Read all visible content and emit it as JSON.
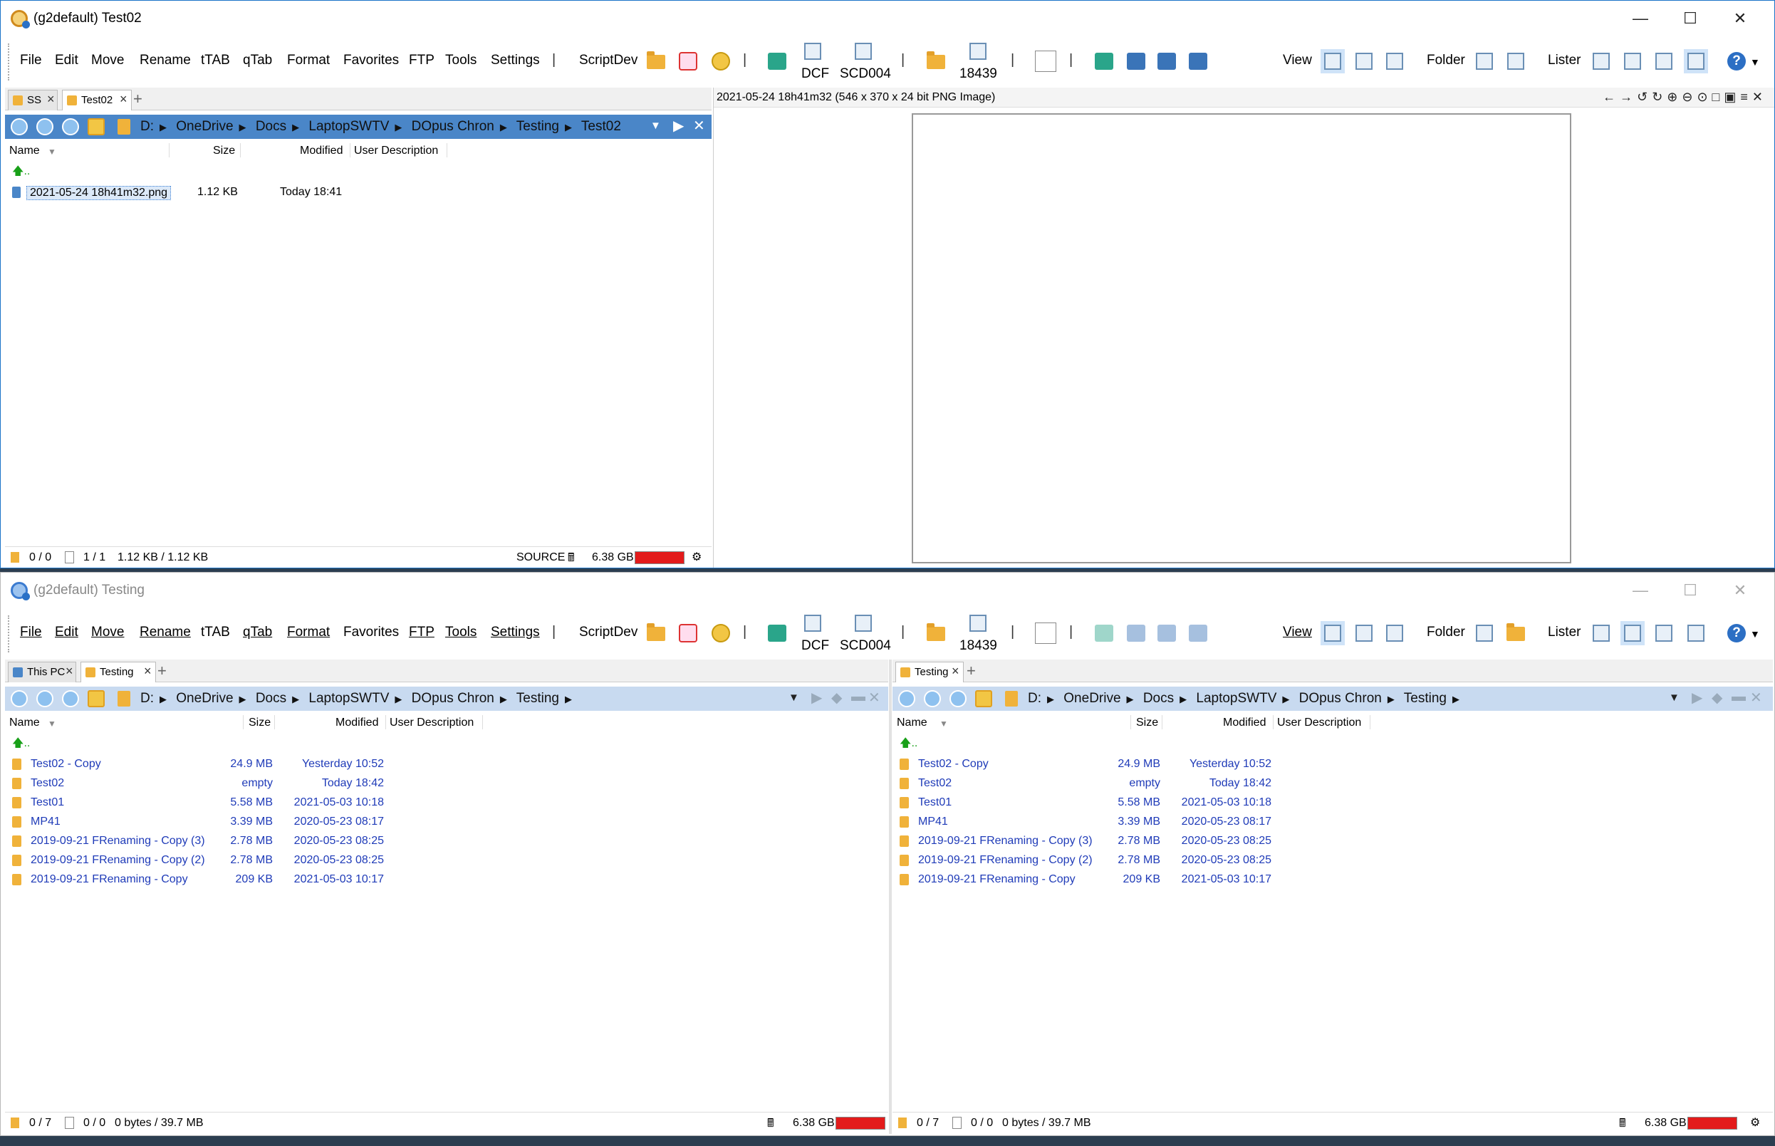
{
  "window1": {
    "title": "(g2default) Test02",
    "menu": [
      "File",
      "Edit",
      "Move",
      "Rename",
      "tTAB",
      "qTab",
      "Format",
      "Favorites",
      "FTP",
      "Tools",
      "Settings"
    ],
    "menu_sep": "|",
    "scriptdev": "ScriptDev",
    "dcf": "DCF",
    "scd004": "SCD004",
    "count_18439": "18439",
    "view_label": "View",
    "folder_label": "Folder",
    "lister_label": "Lister",
    "tabs": [
      {
        "label": "SS"
      },
      {
        "label": "Test02"
      }
    ],
    "path": [
      "D:",
      "OneDrive",
      "Docs",
      "LaptopSWTV",
      "DOpus Chron",
      "Testing",
      "Test02"
    ],
    "columns": {
      "name": "Name",
      "size": "Size",
      "modified": "Modified",
      "desc": "User Description"
    },
    "up": "..",
    "files": [
      {
        "name": "2021-05-24 18h41m32.png",
        "size": "1.12 KB",
        "modified": "Today  18:41"
      }
    ],
    "status": {
      "folders": "0 / 0",
      "files": "1 / 1",
      "bytes": "1.12 KB / 1.12 KB",
      "source": "SOURCE",
      "free": "6.38 GB"
    },
    "viewer_title": "2021-05-24 18h41m32 (546 x 370 x 24 bit PNG Image)"
  },
  "window2": {
    "title": "(g2default) Testing",
    "left_tabs": [
      {
        "label": "This PC"
      },
      {
        "label": "Testing"
      }
    ],
    "right_tabs": [
      {
        "label": "Testing"
      }
    ],
    "path": [
      "D:",
      "OneDrive",
      "Docs",
      "LaptopSWTV",
      "DOpus Chron",
      "Testing"
    ],
    "folders": [
      {
        "name": "Test02 - Copy",
        "size": "24.9 MB",
        "modified": "Yesterday  10:52"
      },
      {
        "name": "Test02",
        "size": "empty",
        "modified": "Today  18:42"
      },
      {
        "name": "Test01",
        "size": "5.58 MB",
        "modified": "2021-05-03  10:18"
      },
      {
        "name": "MP41",
        "size": "3.39 MB",
        "modified": "2020-05-23  08:17"
      },
      {
        "name": "2019-09-21 FRenaming - Copy (3)",
        "size": "2.78 MB",
        "modified": "2020-05-23  08:25"
      },
      {
        "name": "2019-09-21 FRenaming - Copy (2)",
        "size": "2.78 MB",
        "modified": "2020-05-23  08:25"
      },
      {
        "name": "2019-09-21 FRenaming - Copy",
        "size": "209 KB",
        "modified": "2021-05-03  10:17"
      }
    ],
    "status": {
      "folders": "0 / 7",
      "files": "0 / 0",
      "bytes": "0 bytes / 39.7 MB",
      "free": "6.38 GB"
    }
  }
}
